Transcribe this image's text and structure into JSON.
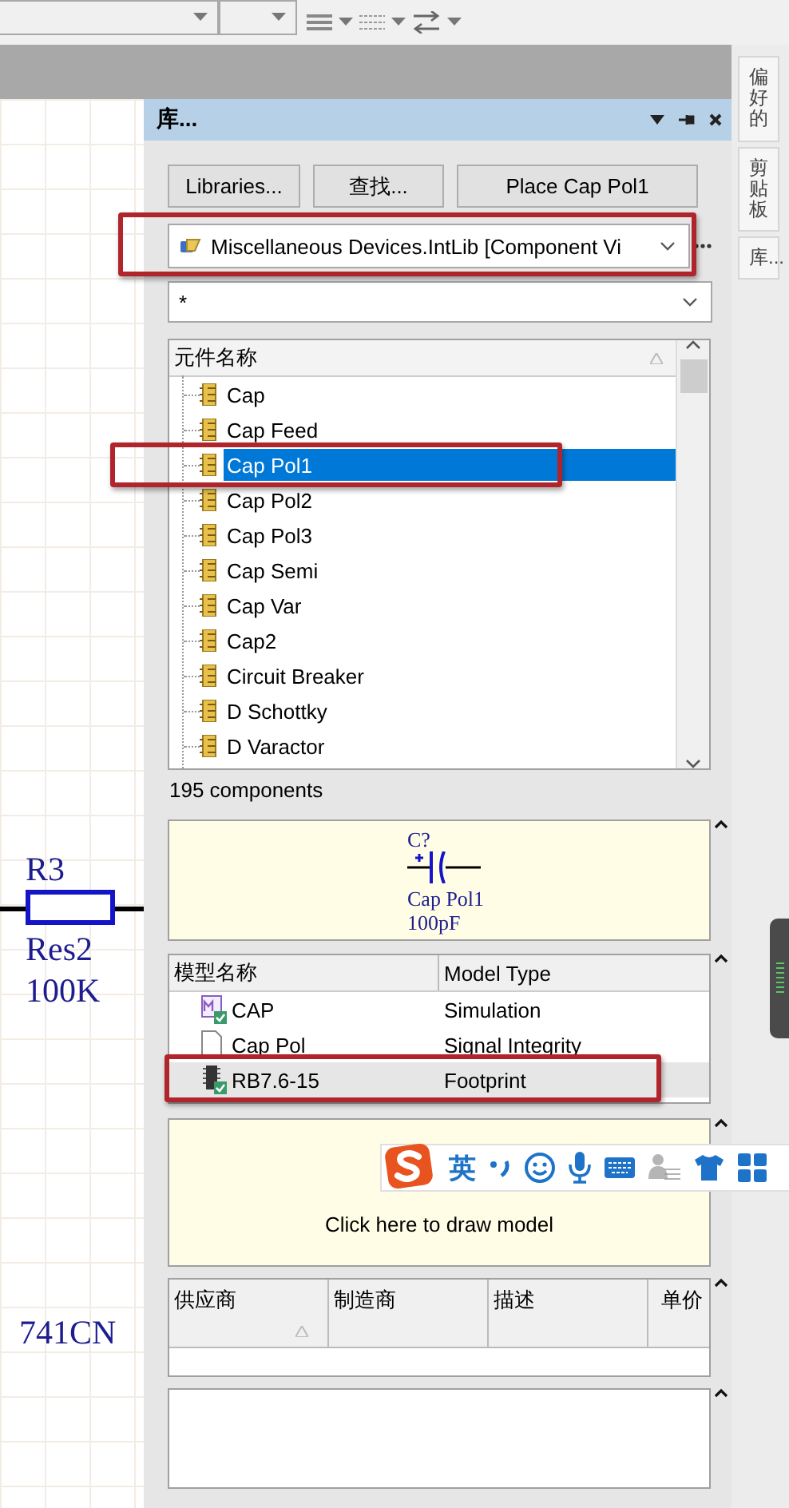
{
  "schematic": {
    "labels": [
      "R3",
      "Res2",
      "100K",
      "741CN"
    ]
  },
  "panel": {
    "title": "库...",
    "buttons": [
      "Libraries...",
      "查找...",
      "Place Cap Pol1"
    ],
    "library": {
      "value": "Miscellaneous Devices.IntLib [Component Vi",
      "marked": true
    },
    "filter": {
      "value": "*"
    },
    "components": {
      "column": "元件名称",
      "items": [
        {
          "name": "Cap",
          "selected": false,
          "marked": false
        },
        {
          "name": "Cap Feed",
          "selected": false,
          "marked": false
        },
        {
          "name": "Cap Pol1",
          "selected": true,
          "marked": true
        },
        {
          "name": "Cap Pol2",
          "selected": false,
          "marked": false
        },
        {
          "name": "Cap Pol3",
          "selected": false,
          "marked": false
        },
        {
          "name": "Cap Semi",
          "selected": false,
          "marked": false
        },
        {
          "name": "Cap Var",
          "selected": false,
          "marked": false
        },
        {
          "name": "Cap2",
          "selected": false,
          "marked": false
        },
        {
          "name": "Circuit Breaker",
          "selected": false,
          "marked": false
        },
        {
          "name": "D Schottky",
          "selected": false,
          "marked": false
        },
        {
          "name": "D Varactor",
          "selected": false,
          "marked": false
        }
      ],
      "count": "195 components"
    },
    "preview": {
      "designator": "C?",
      "comment": "Cap Pol1",
      "value": "100pF"
    },
    "models": {
      "columns": [
        "模型名称",
        "Model Type"
      ],
      "rows": [
        {
          "kind": "simulation",
          "name": "CAP",
          "type": "Simulation",
          "selected": false,
          "marked": false
        },
        {
          "kind": "document",
          "name": "Cap Pol",
          "type": "Signal Integrity",
          "selected": false,
          "marked": false
        },
        {
          "kind": "footprint",
          "name": "RB7.6-15",
          "type": "Footprint",
          "selected": true,
          "marked": true
        }
      ]
    },
    "model_preview": {
      "text": "Click here to draw model"
    },
    "suppliers": {
      "columns": [
        "供应商",
        "制造商",
        "描述",
        "单价"
      ]
    }
  },
  "dock_tabs": [
    "偏好的",
    "剪贴板",
    "库..."
  ],
  "ime_bar": {
    "mode": "英"
  }
}
